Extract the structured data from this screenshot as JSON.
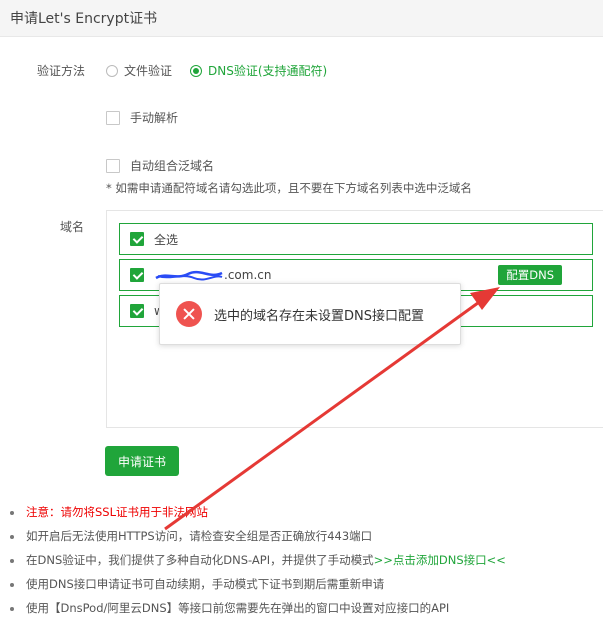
{
  "header": {
    "title": "申请Let's Encrypt证书"
  },
  "verify": {
    "label": "验证方法",
    "options": [
      {
        "label": "文件验证",
        "checked": false
      },
      {
        "label": "DNS验证(支持通配符)",
        "checked": true
      }
    ]
  },
  "manual_parse": {
    "label": "手动解析",
    "checked": false
  },
  "auto_wildcard": {
    "label": "自动组合泛域名",
    "checked": false
  },
  "hint": "* 如需申请通配符域名请勾选此项，且不要在下方域名列表中选中泛域名",
  "domains": {
    "label": "域名",
    "select_all": "全选",
    "items": [
      {
        "text": ".com.cn",
        "dns_button": "配置DNS"
      },
      {
        "text": "w"
      }
    ]
  },
  "toast": {
    "message": "选中的域名存在未设置DNS接口配置"
  },
  "apply_button": "申请证书",
  "notes": {
    "n1": "注意：请勿将SSL证书用于非法网站",
    "n2": "如开启后无法使用HTTPS访问，请检查安全组是否正确放行443端口",
    "n3_prefix": "在DNS验证中，我们提供了多种自动化DNS-API，并提供了手动模式",
    "n3_link": ">>点击添加DNS接口<<",
    "n4": "使用DNS接口申请证书可自动续期，手动模式下证书到期后需重新申请",
    "n5": "使用【DnsPod/阿里云DNS】等接口前您需要先在弹出的窗口中设置对应接口的API"
  },
  "colors": {
    "accent": "#20a53a",
    "error": "#ef5350",
    "warning_text": "#e00000",
    "arrow": "#e53935"
  }
}
